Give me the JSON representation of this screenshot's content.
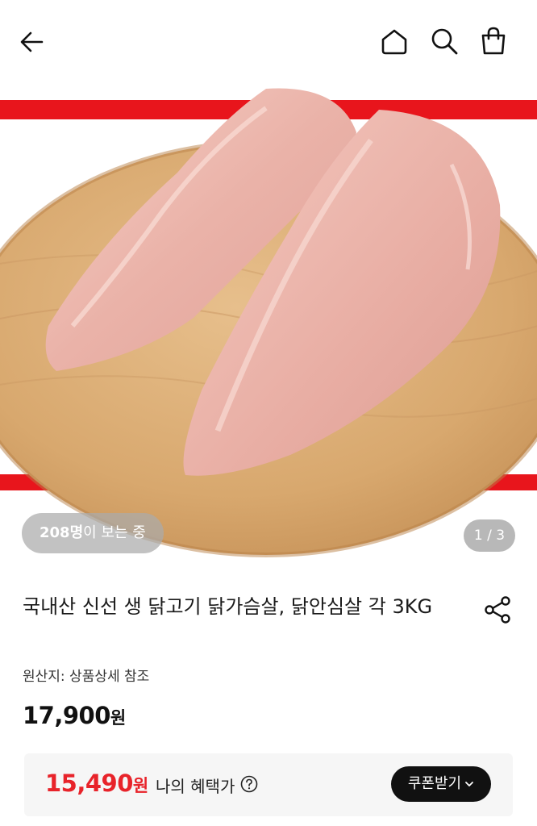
{
  "header": {
    "back_icon": "arrow-left-icon",
    "home_icon": "home-icon",
    "search_icon": "search-icon",
    "cart_icon": "shopping-bag-icon"
  },
  "gallery": {
    "image_alt": "닭가슴살 상품 이미지",
    "viewers_count": "208명",
    "viewers_suffix": "이 보는 중",
    "page_indicator": "1 / 3"
  },
  "product": {
    "title": "국내산 신선 생 닭고기 닭가슴살, 닭안심살 각 3KG",
    "share_icon": "share-icon",
    "origin": "원산지: 상품상세 참조",
    "price_value": "17,900",
    "price_unit": "원"
  },
  "benefit": {
    "price_value": "15,490",
    "price_unit": "원",
    "label": "나의 혜택가",
    "help_icon": "question-circle-icon",
    "coupon_button": "쿠폰받기"
  },
  "colors": {
    "accent_red": "#e8232a",
    "coupon_bg": "#111111",
    "benefit_bg": "#f6f6f6"
  }
}
